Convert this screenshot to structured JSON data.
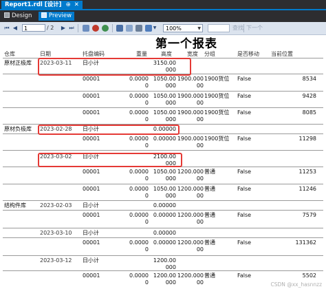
{
  "window": {
    "doc_tab": "Report1.rdl [设计]",
    "pin": "⊕",
    "close": "✕"
  },
  "view_tabs": {
    "design": "Design",
    "preview": "Preview"
  },
  "toolbar": {
    "page_current": "1",
    "page_total": "/ 2",
    "zoom": "100%",
    "find": "查找",
    "next": "下一个"
  },
  "report": {
    "title": "第一个报表",
    "headers": [
      "仓库",
      "日期",
      "托盘编码",
      "重量",
      "高度",
      "宽度",
      "分组",
      "是否移动",
      "当前位置"
    ],
    "rows": [
      {
        "warehouse": "原材正极库",
        "date": "2023-03-11",
        "code": "日小计",
        "weight": "",
        "height": "3150.00\n000",
        "width": "",
        "group": "",
        "moved": "",
        "loc": ""
      },
      {
        "warehouse": "",
        "date": "",
        "code": "00001",
        "weight": "0.0000\n0",
        "height": "1050.00\n000",
        "width": "1900.000\n00",
        "group": "1900货位",
        "moved": "False",
        "loc": "8534"
      },
      {
        "warehouse": "",
        "date": "",
        "code": "00001",
        "weight": "0.0000\n0",
        "height": "1050.00\n000",
        "width": "1900.000\n00",
        "group": "1900货位",
        "moved": "False",
        "loc": "9428"
      },
      {
        "warehouse": "",
        "date": "",
        "code": "00001",
        "weight": "0.0000\n0",
        "height": "1050.00\n000",
        "width": "1900.000\n00",
        "group": "1900货位",
        "moved": "False",
        "loc": "8085"
      },
      {
        "warehouse": "原材负极库",
        "date": "2023-02-28",
        "code": "日小计",
        "weight": "",
        "height": "0.00000",
        "width": "",
        "group": "",
        "moved": "",
        "loc": ""
      },
      {
        "warehouse": "",
        "date": "",
        "code": "00001",
        "weight": "0.0000\n0",
        "height": "0.00000",
        "width": "1900.000\n00",
        "group": "1900货位",
        "moved": "False",
        "loc": "11298"
      },
      {
        "warehouse": "",
        "date": "2023-03-02",
        "code": "日小计",
        "weight": "",
        "height": "2100.00\n000",
        "width": "",
        "group": "",
        "moved": "",
        "loc": ""
      },
      {
        "warehouse": "",
        "date": "",
        "code": "00001",
        "weight": "0.0000\n0",
        "height": "1050.00\n000",
        "width": "1200.000\n00",
        "group": "普通",
        "moved": "False",
        "loc": "11253"
      },
      {
        "warehouse": "",
        "date": "",
        "code": "00001",
        "weight": "0.0000\n0",
        "height": "1050.00\n000",
        "width": "1200.000\n00",
        "group": "普通",
        "moved": "False",
        "loc": "11246"
      },
      {
        "warehouse": "结构件库",
        "date": "2023-02-03",
        "code": "日小计",
        "weight": "",
        "height": "0.00000",
        "width": "",
        "group": "",
        "moved": "",
        "loc": ""
      },
      {
        "warehouse": "",
        "date": "",
        "code": "00001",
        "weight": "0.0000\n0",
        "height": "0.00000",
        "width": "1200.000\n00",
        "group": "普通",
        "moved": "False",
        "loc": "7579"
      },
      {
        "warehouse": "",
        "date": "2023-03-10",
        "code": "日小计",
        "weight": "",
        "height": "0.00000",
        "width": "",
        "group": "",
        "moved": "",
        "loc": ""
      },
      {
        "warehouse": "",
        "date": "",
        "code": "00001",
        "weight": "0.0000\n0",
        "height": "0.00000",
        "width": "1200.000\n00",
        "group": "普通",
        "moved": "False",
        "loc": "131362"
      },
      {
        "warehouse": "",
        "date": "2023-03-12",
        "code": "日小计",
        "weight": "",
        "height": "1200.00\n000",
        "width": "",
        "group": "",
        "moved": "",
        "loc": ""
      },
      {
        "warehouse": "",
        "date": "",
        "code": "00001",
        "weight": "0.0000\n0",
        "height": "1200.00\n000",
        "width": "1200.000\n00",
        "group": "普通",
        "moved": "False",
        "loc": "5502"
      }
    ]
  },
  "watermark": "CSDN @xx_hasnnzz",
  "colors": {
    "accent": "#007acc",
    "highlight_box": "#e53935",
    "toolbar_bg": "#dbe3ee"
  }
}
